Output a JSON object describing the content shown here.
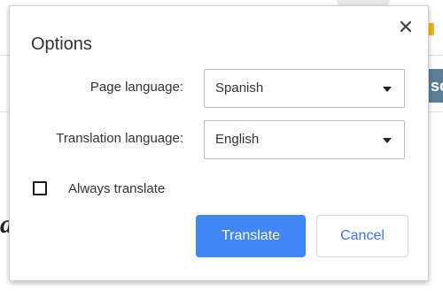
{
  "dialog": {
    "title": "Options",
    "close_icon": "close-icon",
    "page_language": {
      "label": "Page language:",
      "selected": "Spanish"
    },
    "translation_language": {
      "label": "Translation language:",
      "selected": "English"
    },
    "always_translate": {
      "label": "Always translate",
      "checked": false
    },
    "buttons": {
      "translate": "Translate",
      "cancel": "Cancel"
    }
  },
  "background": {
    "side_button_text": "sc"
  },
  "colors": {
    "primary": "#4285f4",
    "cancel_text": "#3b78e7",
    "text": "#333333"
  }
}
